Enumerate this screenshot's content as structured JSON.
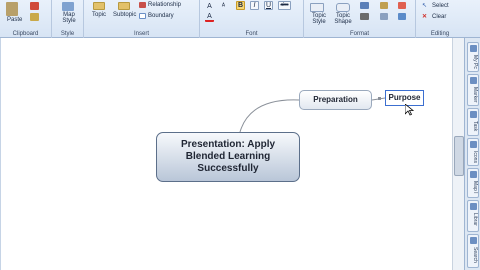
{
  "ribbon": {
    "clipboard": {
      "label": "Clipboard",
      "paste": "Paste"
    },
    "style": {
      "label": "Style",
      "map_style": "Map Style"
    },
    "insert": {
      "label": "Insert",
      "topic": "Topic",
      "subtopic": "Subtopic",
      "relationship": "Relationship",
      "boundary": "Boundary"
    },
    "font": {
      "label": "Font",
      "bold": "B",
      "italic": "I",
      "underline": "U",
      "strike": "abc"
    },
    "format": {
      "label": "Format",
      "topic_style": "Topic Style",
      "topic_shape": "Topic Shape"
    },
    "editing": {
      "label": "Editing",
      "select": "Select",
      "clear": "Clear"
    }
  },
  "sidepanel": {
    "tabs": [
      "My Pc",
      "Marker",
      "Task",
      "Icons",
      "Map I",
      "Librar",
      "Search"
    ]
  },
  "map": {
    "central": "Presentation: Apply Blended Learning Successfully",
    "subtopic": "Preparation",
    "editing_topic": "Purpose"
  },
  "colors": {
    "ribbon_bg": "#dce7f5",
    "selection": "#3c6fd0",
    "connector": "#8a9099"
  }
}
